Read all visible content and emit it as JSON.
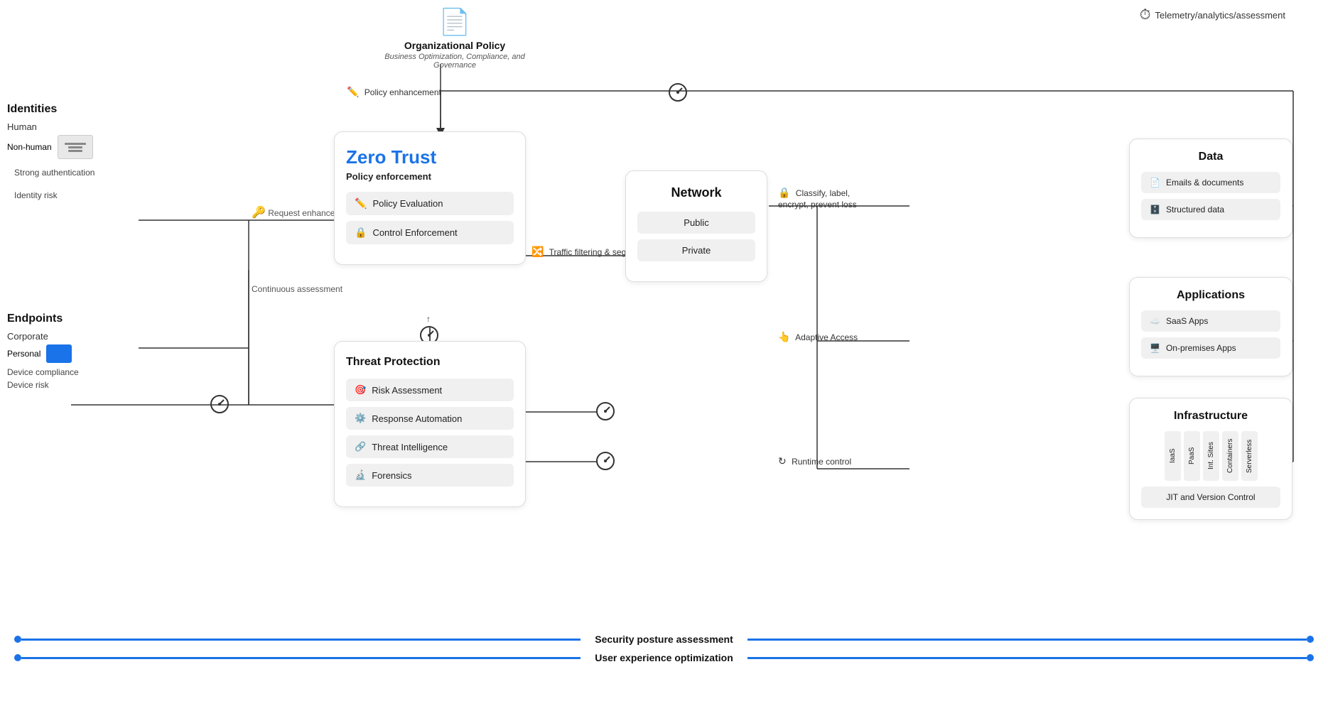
{
  "telemetry": {
    "label": "Telemetry/analytics/assessment"
  },
  "org_policy": {
    "title": "Organizational Policy",
    "subtitle": "Business Optimization, Compliance, and Governance"
  },
  "identities": {
    "title": "Identities",
    "items": [
      {
        "label": "Human"
      },
      {
        "label": "Non-human"
      }
    ],
    "auth_label": "Strong authentication",
    "risk_label": "Identity risk"
  },
  "endpoints": {
    "title": "Endpoints",
    "items": [
      {
        "label": "Corporate"
      },
      {
        "label": "Personal"
      }
    ],
    "compliance_label": "Device compliance",
    "risk_label": "Device risk"
  },
  "zero_trust": {
    "title": "Zero Trust",
    "subtitle": "Policy enforcement",
    "policy_evaluation": "Policy Evaluation",
    "control_enforcement": "Control Enforcement"
  },
  "threat_protection": {
    "title": "Threat Protection",
    "items": [
      {
        "label": "Risk Assessment"
      },
      {
        "label": "Response Automation"
      },
      {
        "label": "Threat Intelligence"
      },
      {
        "label": "Forensics"
      }
    ]
  },
  "network": {
    "title": "Network",
    "items": [
      {
        "label": "Public"
      },
      {
        "label": "Private"
      }
    ]
  },
  "data_box": {
    "title": "Data",
    "items": [
      {
        "label": "Emails & documents"
      },
      {
        "label": "Structured data"
      }
    ]
  },
  "apps_box": {
    "title": "Applications",
    "items": [
      {
        "label": "SaaS Apps"
      },
      {
        "label": "On-premises Apps"
      }
    ]
  },
  "infra_box": {
    "title": "Infrastructure",
    "columns": [
      "IaaS",
      "PaaS",
      "Int. Sites",
      "Containers",
      "Serverless"
    ],
    "jit_label": "JIT and Version Control"
  },
  "labels": {
    "policy_enhancement": "Policy enhancement",
    "request_enhancement": "Request enhancement",
    "continuous_assessment": "Continuous assessment",
    "traffic_filtering": "Traffic filtering & segmentation",
    "classify_label": "Classify, label, encrypt, prevent loss",
    "adaptive_access": "Adaptive Access",
    "runtime_control": "Runtime control",
    "security_posture": "Security posture assessment",
    "user_experience": "User experience optimization"
  }
}
